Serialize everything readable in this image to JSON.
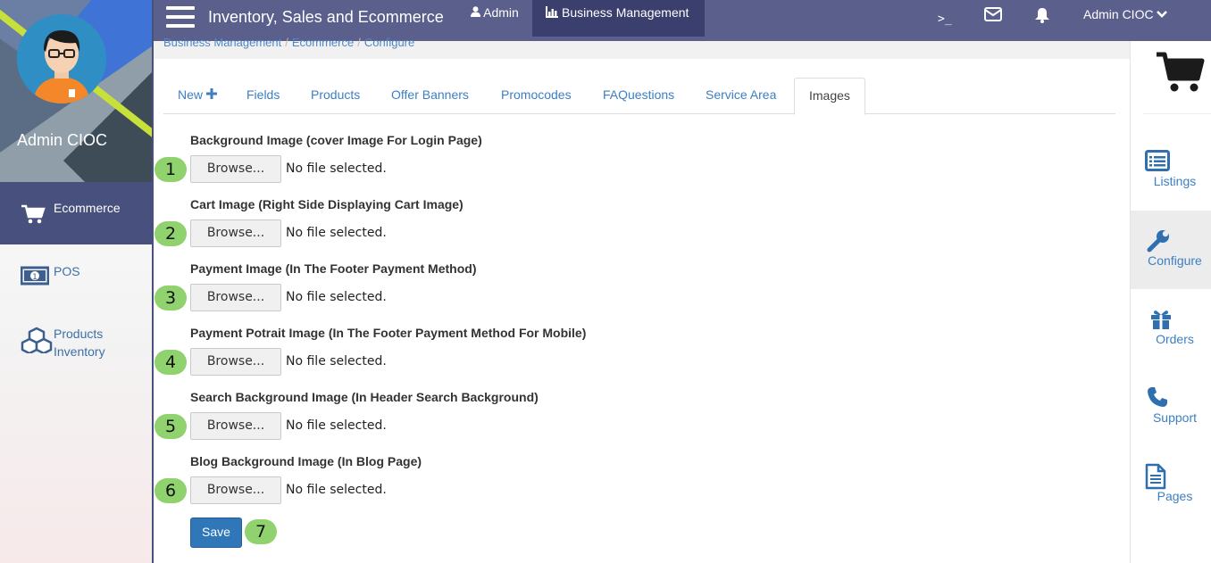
{
  "topbar": {
    "app_title": "Inventory, Sales and Ecommerce",
    "admin_link": "Admin",
    "business_link": "Business Management",
    "terminal_glyph": ">_",
    "user_menu": "Admin CIOC"
  },
  "sidebar": {
    "profile_name": "Admin CIOC",
    "items": [
      {
        "label": "Ecommerce",
        "icon": "cart-icon",
        "active": true
      },
      {
        "label": "POS",
        "icon": "cash-icon",
        "active": false
      },
      {
        "label_line1": "Products",
        "label_line2": "Inventory",
        "icon": "cubes-icon",
        "active": false
      }
    ]
  },
  "breadcrumb": [
    "Business Management",
    "Ecommerce",
    "Configure"
  ],
  "tabs": [
    {
      "label": "New"
    },
    {
      "label": "Fields"
    },
    {
      "label": "Products"
    },
    {
      "label": "Offer Banners"
    },
    {
      "label": "Promocodes"
    },
    {
      "label": "FAQuestions"
    },
    {
      "label": "Service Area"
    },
    {
      "label": "Images",
      "active": true
    }
  ],
  "form": {
    "browse_label": "Browse...",
    "no_file": "No file selected.",
    "fields": [
      {
        "label": "Background Image (cover Image For Login Page)",
        "badge": "1"
      },
      {
        "label": "Cart Image (Right Side Displaying Cart Image)",
        "badge": "2"
      },
      {
        "label": "Payment Image (In The Footer Payment Method)",
        "badge": "3"
      },
      {
        "label": "Payment Potrait Image (In The Footer Payment Method For Mobile)",
        "badge": "4"
      },
      {
        "label": "Search Background Image (In Header Search Background)",
        "badge": "5"
      },
      {
        "label": "Blog Background Image (In Blog Page)",
        "badge": "6"
      }
    ],
    "save_label": "Save",
    "save_badge": "7"
  },
  "rightbar": {
    "items": [
      {
        "label": "Listings",
        "icon": "list-icon"
      },
      {
        "label": "Configure",
        "icon": "wrench-icon",
        "active": true
      },
      {
        "label": "Orders",
        "icon": "gift-icon"
      },
      {
        "label": "Support",
        "icon": "phone-icon"
      },
      {
        "label": "Pages",
        "icon": "document-icon"
      }
    ]
  },
  "colors": {
    "topbar": "#5a5f8c",
    "active_nav": "#48517d",
    "link": "#3d7fc2",
    "badge": "#8fd26e",
    "save": "#2f77b8"
  }
}
